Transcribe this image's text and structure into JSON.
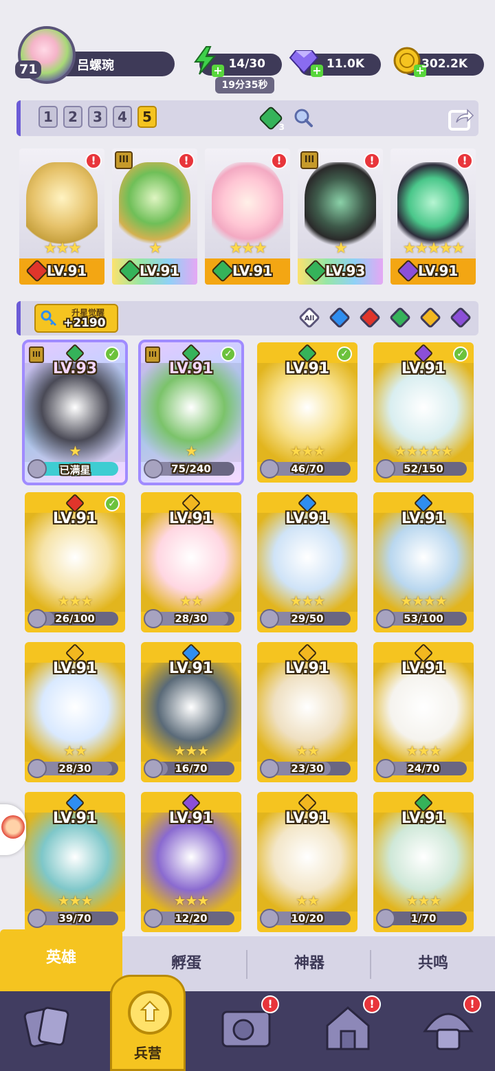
{
  "player": {
    "level": "71",
    "name": "吕螺琬"
  },
  "resources": {
    "energy": "14/30",
    "energy_timer": "19分35秒",
    "gems": "11.0K",
    "gold": "302.2K"
  },
  "team_tabs": [
    "1",
    "2",
    "3",
    "4",
    "5"
  ],
  "team_gem_count": "3",
  "team": [
    {
      "level": "LV.91",
      "element": "fire",
      "stars": "★★★",
      "alert": "!",
      "tier": ""
    },
    {
      "level": "LV.91",
      "element": "nature",
      "stars": "★",
      "alert": "!",
      "tier": "III"
    },
    {
      "level": "LV.91",
      "element": "nature",
      "stars": "★★★",
      "alert": "!",
      "tier": ""
    },
    {
      "level": "LV.93",
      "element": "nature",
      "stars": "★",
      "alert": "!",
      "tier": "III"
    },
    {
      "level": "LV.91",
      "element": "dark",
      "stars": "★★★★★",
      "alert": "!",
      "tier": ""
    }
  ],
  "awaken": {
    "label": "升星觉醒",
    "value": "+2190"
  },
  "filters": [
    "All",
    "water",
    "fire",
    "nature",
    "light",
    "dark"
  ],
  "heroes": [
    {
      "level": "LV.93",
      "element": "nature",
      "progress": "已满星",
      "full": true,
      "fill": 1.0,
      "check": true,
      "tier": "III",
      "stars": "★",
      "purple": true
    },
    {
      "level": "LV.91",
      "element": "nature",
      "progress": "75/240",
      "full": false,
      "fill": 0.31,
      "check": true,
      "tier": "III",
      "stars": "★",
      "purple": true
    },
    {
      "level": "LV.91",
      "element": "nature",
      "progress": "46/70",
      "full": false,
      "fill": 0.66,
      "check": true,
      "tier": "",
      "stars": "★★★",
      "purple": false
    },
    {
      "level": "LV.91",
      "element": "dark",
      "progress": "52/150",
      "full": false,
      "fill": 0.35,
      "check": true,
      "tier": "",
      "stars": "★★★★★",
      "purple": false
    },
    {
      "level": "LV.91",
      "element": "fire",
      "progress": "26/100",
      "full": false,
      "fill": 0.26,
      "check": true,
      "tier": "",
      "stars": "★★★",
      "purple": false
    },
    {
      "level": "LV.91",
      "element": "light",
      "progress": "28/30",
      "full": false,
      "fill": 0.93,
      "check": false,
      "tier": "",
      "stars": "★★",
      "purple": false
    },
    {
      "level": "LV.91",
      "element": "water",
      "progress": "29/50",
      "full": false,
      "fill": 0.58,
      "check": false,
      "tier": "",
      "stars": "★★★",
      "purple": false
    },
    {
      "level": "LV.91",
      "element": "water",
      "progress": "53/100",
      "full": false,
      "fill": 0.53,
      "check": false,
      "tier": "",
      "stars": "★★★★",
      "purple": false
    },
    {
      "level": "LV.91",
      "element": "light",
      "progress": "28/30",
      "full": false,
      "fill": 0.93,
      "check": false,
      "tier": "",
      "stars": "★★",
      "purple": false
    },
    {
      "level": "LV.91",
      "element": "water",
      "progress": "16/70",
      "full": false,
      "fill": 0.23,
      "check": false,
      "tier": "",
      "stars": "★★★",
      "purple": false
    },
    {
      "level": "LV.91",
      "element": "light",
      "progress": "23/30",
      "full": false,
      "fill": 0.77,
      "check": false,
      "tier": "",
      "stars": "★★",
      "purple": false
    },
    {
      "level": "LV.91",
      "element": "light",
      "progress": "24/70",
      "full": false,
      "fill": 0.34,
      "check": false,
      "tier": "",
      "stars": "★★★",
      "purple": false
    },
    {
      "level": "LV.91",
      "element": "water",
      "progress": "39/70",
      "full": false,
      "fill": 0.56,
      "check": false,
      "tier": "",
      "stars": "★★★",
      "purple": false
    },
    {
      "level": "LV.91",
      "element": "dark",
      "progress": "12/20",
      "full": false,
      "fill": 0.6,
      "check": false,
      "tier": "",
      "stars": "★★★",
      "purple": false
    },
    {
      "level": "LV.91",
      "element": "light",
      "progress": "10/20",
      "full": false,
      "fill": 0.5,
      "check": false,
      "tier": "",
      "stars": "★★",
      "purple": false
    },
    {
      "level": "LV.91",
      "element": "nature",
      "progress": "1/70",
      "full": false,
      "fill": 0.02,
      "check": false,
      "tier": "",
      "stars": "★★★",
      "purple": false
    }
  ],
  "subtabs": [
    "英雄",
    "孵蛋",
    "神器",
    "共鸣"
  ],
  "bottom_nav": {
    "active_label": "兵营",
    "alert": "!"
  },
  "colors": {
    "fire": "#e0352b",
    "water": "#2f8ef0",
    "nature": "#35b35a",
    "light": "#f2b720",
    "dark": "#8b4fd8",
    "accent": "#f5c420"
  }
}
